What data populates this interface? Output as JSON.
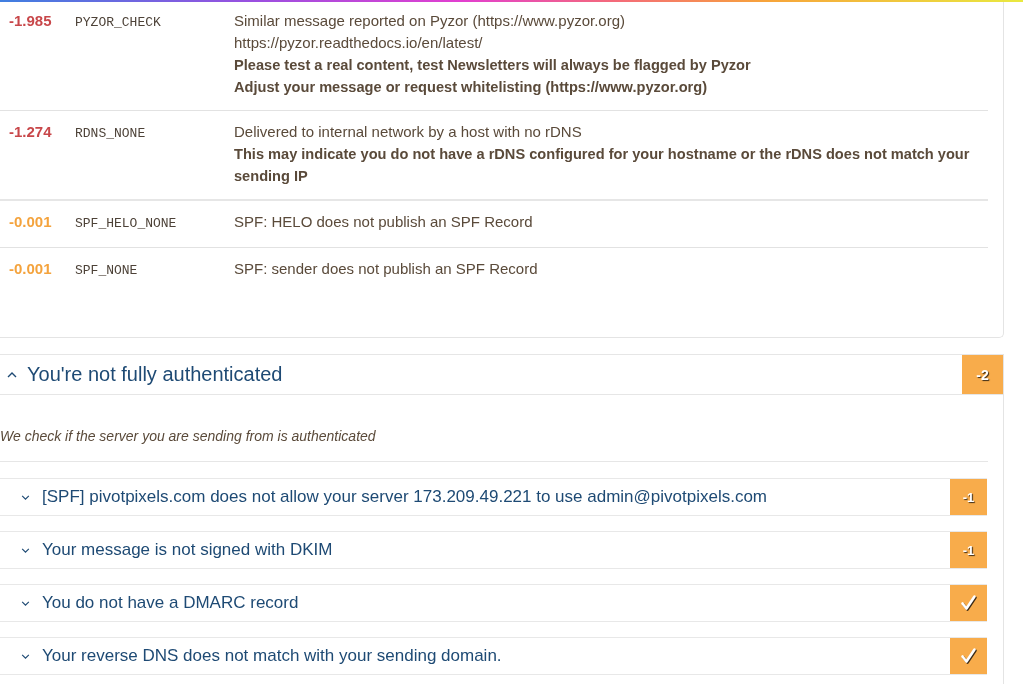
{
  "spam_rules": [
    {
      "score": "-1.985",
      "color": "#c8474a",
      "name": "PYZOR_CHECK",
      "lines": [
        {
          "text": "Similar message reported on Pyzor (https://www.pyzor.org)",
          "strong": false
        },
        {
          "text": "https://pyzor.readthedocs.io/en/latest/",
          "strong": false
        },
        {
          "text": "Please test a real content, test Newsletters will always be flagged by Pyzor",
          "strong": true
        },
        {
          "text": "Adjust your message or request whitelisting (https://www.pyzor.org)",
          "strong": true
        }
      ]
    },
    {
      "score": "-1.274",
      "color": "#c8474a",
      "name": "RDNS_NONE",
      "lines": [
        {
          "text": "Delivered to internal network by a host with no rDNS",
          "strong": false
        },
        {
          "text": "This may indicate you do not have a rDNS configured for your hostname or the rDNS does not match your sending IP",
          "strong": true
        }
      ]
    },
    {
      "score": "-0.001",
      "color": "#f4a33d",
      "name": "SPF_HELO_NONE",
      "lines": [
        {
          "text": "SPF: HELO does not publish an SPF Record",
          "strong": false
        }
      ]
    },
    {
      "score": "-0.001",
      "color": "#f4a33d",
      "name": "SPF_NONE",
      "lines": [
        {
          "text": "SPF: sender does not publish an SPF Record",
          "strong": false
        }
      ]
    }
  ],
  "auth_section": {
    "title": "You're not fully authenticated",
    "expanded": true,
    "score": "-2",
    "description": "We check if the server you are sending from is authenticated",
    "checks": [
      {
        "title": "[SPF] pivotpixels.com does not allow your server 173.209.49.221 to use admin@pivotpixels.com",
        "expanded": false,
        "kind": "penalty",
        "score": "-1"
      },
      {
        "title": "Your message is not signed with DKIM",
        "expanded": false,
        "kind": "penalty",
        "score": "-1"
      },
      {
        "title": "You do not have a DMARC record",
        "expanded": false,
        "kind": "pass"
      },
      {
        "title": "Your reverse DNS does not match with your sending domain.",
        "expanded": false,
        "kind": "pass"
      }
    ]
  }
}
